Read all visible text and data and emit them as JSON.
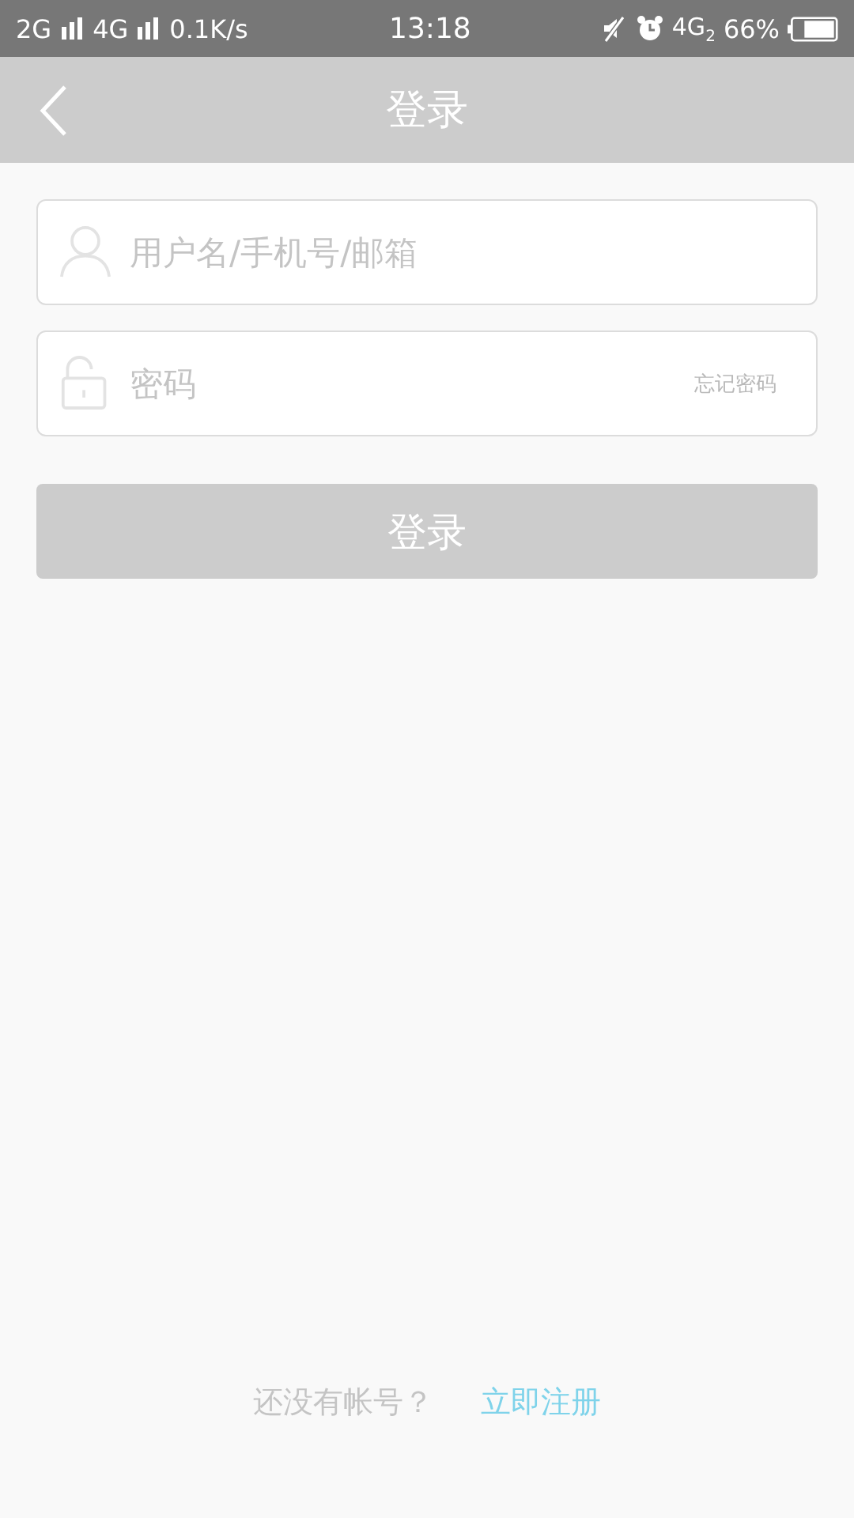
{
  "status_bar": {
    "network_1": "2G",
    "network_2": "4G",
    "speed": "0.1K/s",
    "time": "13:18",
    "network_3": "4G",
    "network_3_sub": "2",
    "battery_percent": "66%"
  },
  "header": {
    "title": "登录"
  },
  "username_field": {
    "placeholder": "用户名/手机号/邮箱"
  },
  "password_field": {
    "placeholder": "密码",
    "forgot_link": "忘记密码"
  },
  "login_button": {
    "label": "登录",
    "disabled": true
  },
  "footer": {
    "prompt": "还没有帐号？",
    "register_link": "立即注册"
  }
}
